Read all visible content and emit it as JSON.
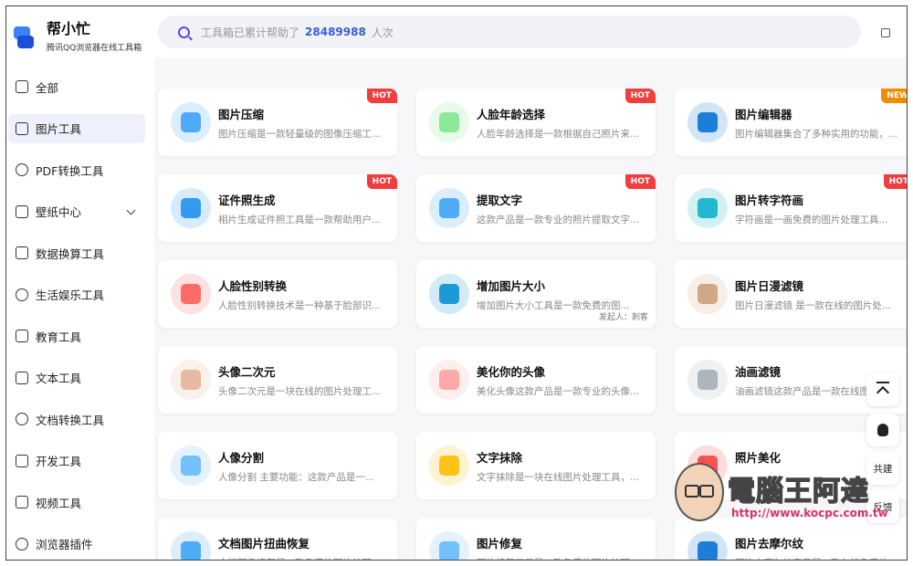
{
  "brand": {
    "title": "帮小忙",
    "subtitle": "腾讯QQ浏览器在线工具箱"
  },
  "sidebar": {
    "items": [
      {
        "label": "全部",
        "icon": "grid-icon",
        "active": false
      },
      {
        "label": "图片工具",
        "icon": "image-icon",
        "active": true
      },
      {
        "label": "PDF转换工具",
        "icon": "pdf-icon",
        "active": false
      },
      {
        "label": "壁纸中心",
        "icon": "wallpaper-icon",
        "active": false,
        "expandable": true
      },
      {
        "label": "数据换算工具",
        "icon": "chart-icon",
        "active": false
      },
      {
        "label": "生活娱乐工具",
        "icon": "life-icon",
        "active": false
      },
      {
        "label": "教育工具",
        "icon": "education-icon",
        "active": false
      },
      {
        "label": "文本工具",
        "icon": "text-icon",
        "active": false
      },
      {
        "label": "文档转换工具",
        "icon": "document-icon",
        "active": false
      },
      {
        "label": "开发工具",
        "icon": "terminal-icon",
        "active": false
      },
      {
        "label": "视频工具",
        "icon": "video-icon",
        "active": false
      },
      {
        "label": "浏览器插件",
        "icon": "plugin-icon",
        "active": false
      }
    ]
  },
  "search": {
    "prefix": "工具箱已累计帮助了",
    "count": "28489988",
    "suffix": "人次"
  },
  "cards": [
    {
      "title": "图片压缩",
      "desc": "图片压缩是一款轻量级的图像压缩工...",
      "badge": "HOT",
      "icon_color": "#4dabf7",
      "icon": "image-compress-icon"
    },
    {
      "title": "人脸年龄选择",
      "desc": "人脸年龄选择是一款根据自己照片来...",
      "badge": "HOT",
      "icon_color": "#8ce99a",
      "icon": "face-age-icon"
    },
    {
      "title": "图片编辑器",
      "desc": "图片编辑器集合了多种实用的功能，...",
      "badge": "NEW",
      "icon_color": "#1c7ed6",
      "icon": "image-editor-icon"
    },
    {
      "title": "证件照生成",
      "desc": "相片生成证件照工具是一款帮助用户...",
      "badge": "HOT",
      "icon_color": "#339af0",
      "icon": "id-photo-icon"
    },
    {
      "title": "提取文字",
      "desc": "这款产品是一款专业的照片提取文字...",
      "badge": "HOT",
      "icon_color": "#4dabf7",
      "icon": "extract-text-icon"
    },
    {
      "title": "图片转字符画",
      "desc": "字符画是一画免费的图片处理工具...",
      "badge": "HOT",
      "icon_color": "#22b8cf",
      "icon": "ascii-art-icon"
    },
    {
      "title": "人脸性别转换",
      "desc": "人脸性别转换技术是一种基于脸部识...",
      "badge": "",
      "icon_color": "#ff6b6b",
      "icon": "gender-swap-icon"
    },
    {
      "title": "增加图片大小",
      "desc": "增加图片大小工具是一款免费的图...",
      "badge": "",
      "icon_color": "#1c9ad6",
      "icon": "resize-icon",
      "publisher": "发起人：刺客"
    },
    {
      "title": "图片日漫滤镜",
      "desc": "图片日漫滤镜 是一款在线的图片处...",
      "badge": "",
      "icon_color": "#d0a887",
      "icon": "anime-filter-icon"
    },
    {
      "title": "头像二次元",
      "desc": "头像二次元是一块在线的图片处理工...",
      "badge": "",
      "icon_color": "#e8b9a0",
      "icon": "anime-avatar-icon"
    },
    {
      "title": "美化你的头像",
      "desc": "美化头像这款产品是一款专业的头像...",
      "badge": "",
      "icon_color": "#ffa8a8",
      "icon": "beautify-avatar-icon"
    },
    {
      "title": "油画滤镜",
      "desc": "油画滤镜这款产品是一款在线图",
      "badge": "",
      "icon_color": "#adb5bd",
      "icon": "oil-paint-icon"
    },
    {
      "title": "人像分割",
      "desc": "人像分割 主要功能：这款产品是一...",
      "badge": "",
      "icon_color": "#74c0fc",
      "icon": "portrait-segment-icon"
    },
    {
      "title": "文字抹除",
      "desc": "文字抹除是一块在线图片处理工具，...",
      "badge": "",
      "icon_color": "#fcc419",
      "icon": "text-erase-icon"
    },
    {
      "title": "照片美化",
      "desc": "",
      "badge": "",
      "icon_color": "#fa5252",
      "icon": "photo-beautify-icon"
    },
    {
      "title": "文档图片扭曲恢复",
      "desc": "文档图像修复是一款免费的图片处理",
      "badge": "",
      "icon_color": "#4dabf7",
      "icon": "document-restore-icon"
    },
    {
      "title": "图片修复",
      "desc": "图片修复工具是一款免费的图片处理",
      "badge": "",
      "icon_color": "#74c0fc",
      "icon": "image-repair-icon"
    },
    {
      "title": "图片去摩尔纹",
      "desc": "图片去摩尔纹产品是一款在线免费的",
      "badge": "",
      "icon_color": "#1c7ed6",
      "icon": "moire-removal-icon"
    }
  ],
  "float_buttons": {
    "top_label": "",
    "share_label": "共建",
    "feedback_label": "反馈"
  },
  "watermark": {
    "title": "電腦王阿達",
    "url": "http://www.kocpc.com.tw"
  }
}
